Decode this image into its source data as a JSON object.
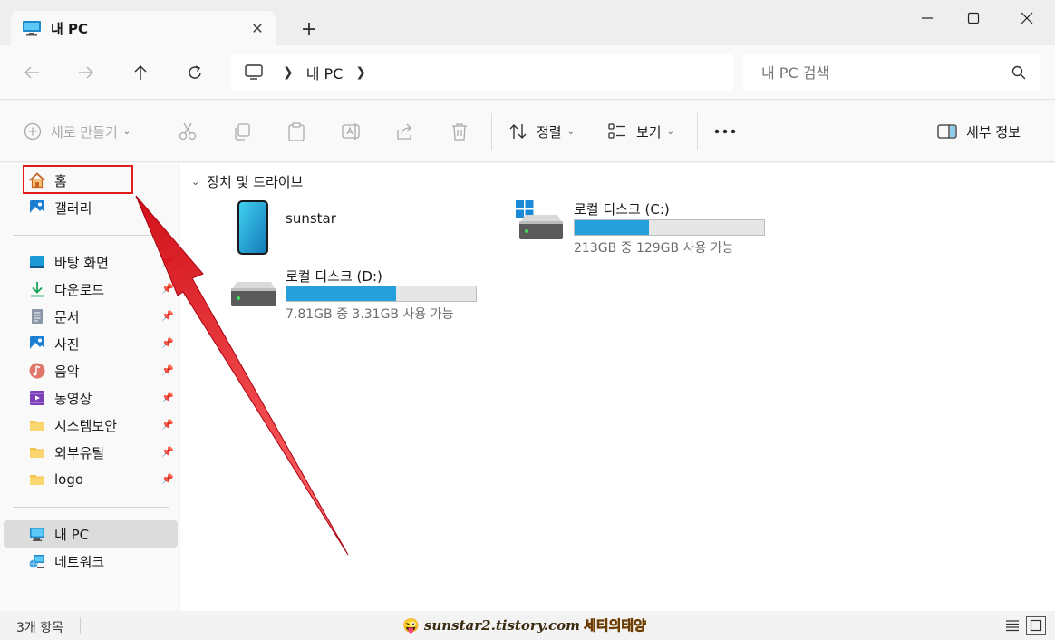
{
  "window": {
    "tab_title": "내 PC",
    "new_tab_symbol": "+"
  },
  "nav": {
    "address_segments": [
      "내 PC"
    ],
    "search_placeholder": "내 PC 검색"
  },
  "toolbar": {
    "new_label": "새로 만들기",
    "sort_label": "정렬",
    "view_label": "보기",
    "details_label": "세부 정보"
  },
  "sidebar": {
    "quick": [
      {
        "label": "홈",
        "icon": "home-icon"
      },
      {
        "label": "갤러리",
        "icon": "gallery-icon"
      }
    ],
    "pinned": [
      {
        "label": "바탕 화면",
        "icon": "desktop-icon"
      },
      {
        "label": "다운로드",
        "icon": "download-icon"
      },
      {
        "label": "문서",
        "icon": "document-icon"
      },
      {
        "label": "사진",
        "icon": "pictures-icon"
      },
      {
        "label": "음악",
        "icon": "music-icon"
      },
      {
        "label": "동영상",
        "icon": "video-icon"
      },
      {
        "label": "시스템보안",
        "icon": "folder-icon"
      },
      {
        "label": "외부유틸",
        "icon": "folder-icon"
      },
      {
        "label": "logo",
        "icon": "folder-icon"
      }
    ],
    "locations": [
      {
        "label": "내 PC",
        "icon": "computer-icon",
        "selected": true
      },
      {
        "label": "네트워크",
        "icon": "network-icon"
      }
    ]
  },
  "content": {
    "group_title": "장치 및 드라이브",
    "devices": [
      {
        "name": "sunstar",
        "icon": "phone-icon"
      },
      {
        "name": "로컬 디스크 (C:)",
        "info": "213GB 중 129GB 사용 가능",
        "used_fraction": 0.39,
        "icon": "windows-drive-icon"
      },
      {
        "name": "로컬 디스크 (D:)",
        "info": "7.81GB 중 3.31GB 사용 가능",
        "used_fraction": 0.58,
        "icon": "drive-icon"
      }
    ]
  },
  "status": {
    "item_count": "3개 항목",
    "watermark_url": "sunstar2.tistory.com",
    "watermark_name": "세티의태양"
  },
  "colors": {
    "accent": "#26a0da",
    "highlight": "#e01c1c"
  }
}
